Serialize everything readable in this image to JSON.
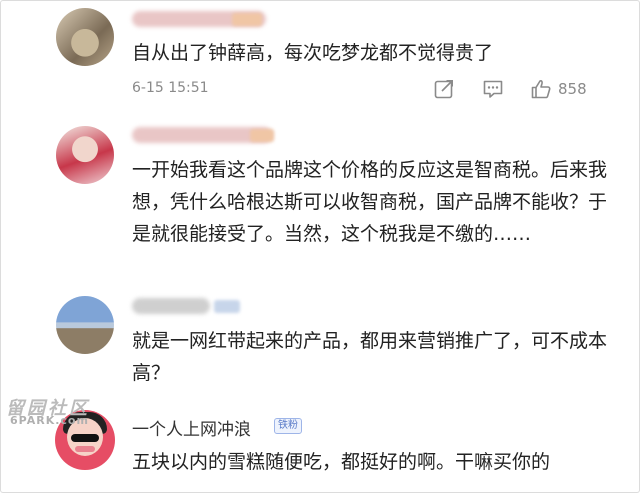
{
  "comments": [
    {
      "text": "自从出了钟薛高，每次吃梦龙都不觉得贵了",
      "time": "6-15 15:51",
      "like_count": "858",
      "icons": [
        "share-icon",
        "comment-icon",
        "thumbs-up-icon"
      ]
    },
    {
      "text": "一开始我看这个品牌这个价格的反应这是智商税。后来我想，凭什么哈根达斯可以收智商税，国产品牌不能收？于是就很能接受了。当然，这个税我是不缴的……"
    },
    {
      "text": "就是一网红带起来的产品，都用来营销推广了，可不成本高？"
    },
    {
      "username": "一个人上网冲浪",
      "badge": "铁粉",
      "text": "五块以内的雪糕随便吃，都挺好的啊。干嘛买你的"
    }
  ],
  "watermark": {
    "line1": "留园社区",
    "line2": "6PARK.com"
  }
}
